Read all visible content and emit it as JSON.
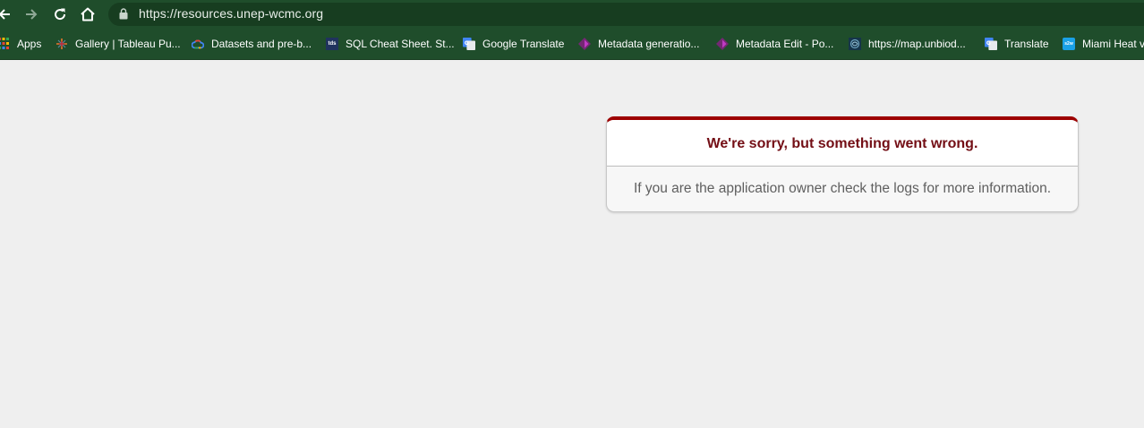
{
  "browser": {
    "url": "https://resources.unep-wcmc.org",
    "bookmarks": [
      {
        "label": "Apps",
        "icon": "apps-grid-icon"
      },
      {
        "label": "Gallery | Tableau Pu...",
        "icon": "tableau-icon"
      },
      {
        "label": "Datasets and pre-b...",
        "icon": "google-cloud-icon"
      },
      {
        "label": "SQL Cheat Sheet. St...",
        "icon": "tds-icon",
        "icon_text": "tds"
      },
      {
        "label": "Google Translate",
        "icon": "google-translate-icon"
      },
      {
        "label": "Metadata generatio...",
        "icon": "powerapps-icon"
      },
      {
        "label": "Metadata Edit - Po...",
        "icon": "powerapps-icon"
      },
      {
        "label": "https://map.unbiod...",
        "icon": "unbiodiversity-map-icon"
      },
      {
        "label": "Translate",
        "icon": "google-translate-icon"
      },
      {
        "label": "Miami Heat v",
        "icon": "stream-icon",
        "icon_text": "s2w"
      }
    ]
  },
  "error": {
    "title": "We're sorry, but something went wrong.",
    "message": "If you are the application owner check the logs for more information."
  },
  "colors": {
    "chrome": "#1f4d2b",
    "omnibox": "#173d20",
    "page_bg": "#efefef",
    "error_accent": "#9d0000",
    "error_title": "#730e15",
    "error_text": "#5f5f5f"
  }
}
